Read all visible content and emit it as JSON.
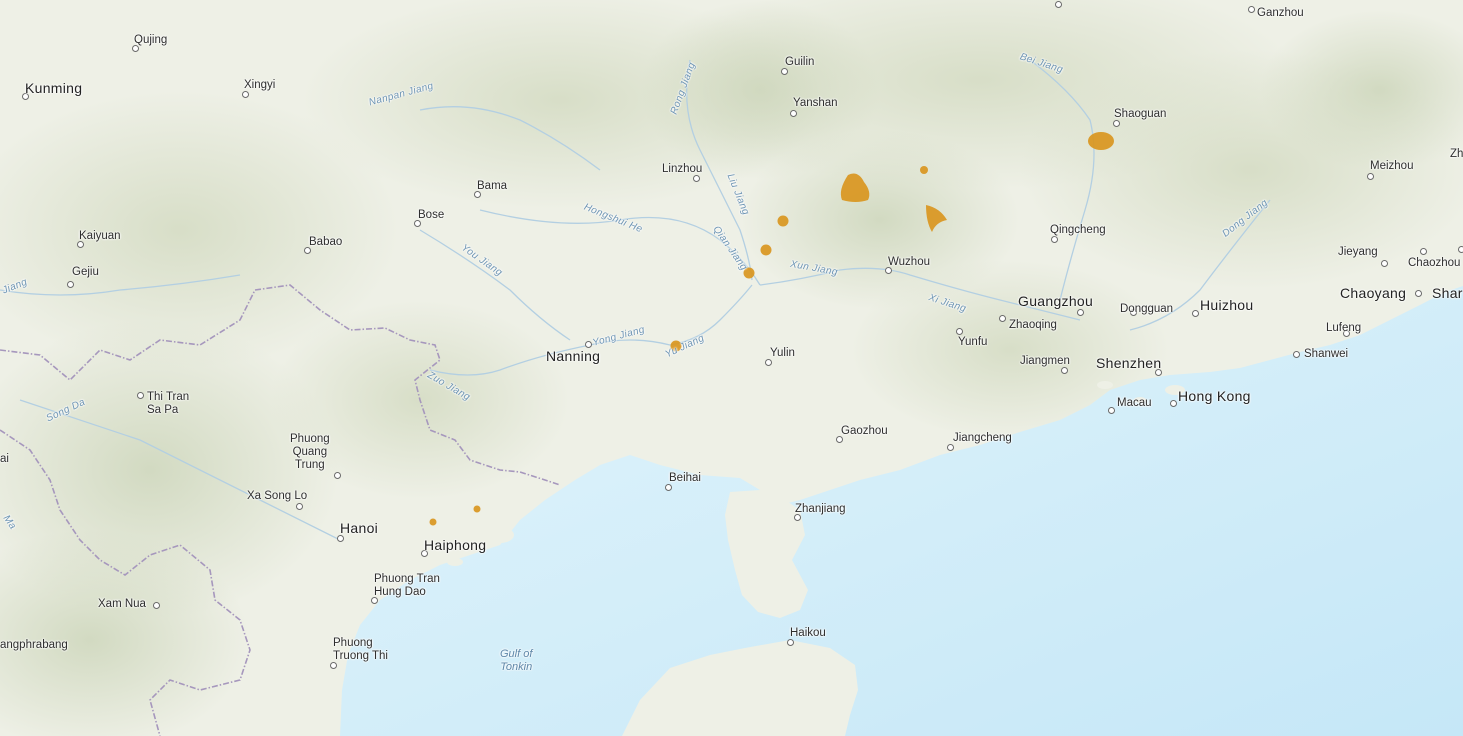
{
  "map": {
    "colors": {
      "land": "#eef0e6",
      "hills": "#dfe4d2",
      "water": "#d6f0fb",
      "deep_water": "#c7e9f8",
      "border": "#a393b8",
      "river": "#a9c9de",
      "feature": "#d9961f"
    },
    "labels": {
      "kunming": "Kunming",
      "qujing": "Qujing",
      "xingyi": "Xingyi",
      "kaiyuan": "Kaiyuan",
      "gejiu": "Gejiu",
      "bose": "Bose",
      "babao": "Babao",
      "bama": "Bama",
      "linzhou": "Linzhou",
      "guilin": "Guilin",
      "yanshan": "Yanshan",
      "ganzhou": "Ganzhou",
      "shaoguan": "Shaoguan",
      "meizhou": "Meizhou",
      "qingcheng": "Qingcheng",
      "wuzhou": "Wuzhou",
      "guangzhou": "Guangzhou",
      "dongguan": "Dongguan",
      "huizhou": "Huizhou",
      "zhaoqing": "Zhaoqing",
      "yunfu": "Yunfu",
      "jiangmen": "Jiangmen",
      "shenzhen": "Shenzhen",
      "hongkong": "Hong Kong",
      "macau": "Macau",
      "jieyang": "Jieyang",
      "chaozhou": "Chaozhou",
      "chaoyang": "Chaoyang",
      "shantou": "Shar",
      "lufeng": "Lufeng",
      "shanwei": "Shanwei",
      "nanning": "Nanning",
      "yulin": "Yulin",
      "gaozhou": "Gaozhou",
      "jiangcheng": "Jiangcheng",
      "beihai": "Beihai",
      "zhanjiang": "Zhanjiang",
      "haikou": "Haikou",
      "hanoi": "Hanoi",
      "haiphong": "Haiphong",
      "thitran": "Thi Tran\nSa Pa",
      "phuongquang": "Phuong\nQuang\nTrung",
      "xasonglo": "Xa Song Lo",
      "phuongtran": "Phuong Tran\nHung Dao",
      "phuongtruong": "Phuong\nTruong Thi",
      "xamnua": "Xam Nua",
      "luangprabang": "angphrabang",
      "zh_edge": "Zh",
      "li_edge": "ai"
    },
    "rivers": {
      "nanpan": "Nanpan Jiang",
      "rong": "Rong Jiang",
      "liu": "Liu Jiang",
      "hongshui": "Hongshui He",
      "you": "You Jiang",
      "qian": "Qian Jiang",
      "xun": "Xun Jiang",
      "yong": "Yong Jiang",
      "zuo": "Zuo Jiang",
      "yu": "Yu Jiang",
      "xi": "Xi Jiang",
      "bei": "Bei Jiang",
      "dong": "Dong Jiang",
      "song_da": "Song Da",
      "jiang_edge": "Jiang",
      "ma_edge": "Ma"
    },
    "water_bodies": {
      "gulf": "Gulf of\nTonkin"
    }
  }
}
